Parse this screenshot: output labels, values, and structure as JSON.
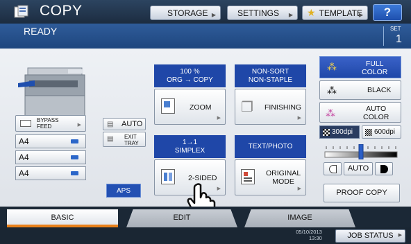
{
  "header": {
    "title": "COPY",
    "storage_label": "STORAGE",
    "settings_label": "SETTINGS",
    "template_label": "TEMPLATE",
    "help_label": "?"
  },
  "status": {
    "state": "READY",
    "set_label": "SET",
    "set_value": "1"
  },
  "machine": {
    "bypass_label_1": "BYPASS",
    "bypass_label_2": "FEED",
    "auto_label": "AUTO",
    "exit_label_1": "EXIT",
    "exit_label_2": "TRAY",
    "trays": [
      "A4",
      "A4",
      "A4"
    ],
    "aps_label": "APS"
  },
  "functions": {
    "zoom_info_1": "100 %",
    "zoom_info_2": "ORG → COPY",
    "zoom_label": "ZOOM",
    "finishing_info_1": "NON-SORT",
    "finishing_info_2": "NON-STAPLE",
    "finishing_label": "FINISHING",
    "duplex_info_1": "1→1",
    "duplex_info_2": "SIMPLEX",
    "duplex_label": "2-SIDED",
    "mode_info": "TEXT/PHOTO",
    "mode_label_1": "ORIGINAL",
    "mode_label_2": "MODE"
  },
  "color": {
    "full_1": "FULL",
    "full_2": "COLOR",
    "black": "BLACK",
    "auto_1": "AUTO",
    "auto_2": "COLOR",
    "res_300": "300dpi",
    "res_600": "600dpi",
    "density_auto": "AUTO",
    "proof_copy": "PROOF COPY"
  },
  "tabs": {
    "basic": "BASIC",
    "edit": "EDIT",
    "image": "IMAGE"
  },
  "footer": {
    "date": "05/10/2013",
    "time": "13:30",
    "job_status": "JOB STATUS"
  }
}
